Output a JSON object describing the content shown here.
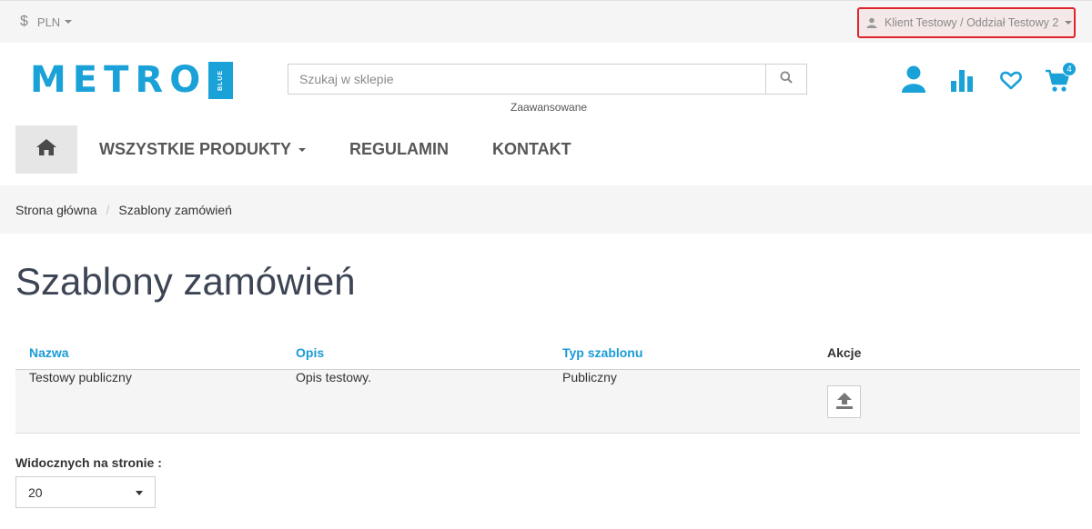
{
  "topbar": {
    "currency_symbol": "$",
    "currency": "PLN",
    "account_label": "Klient Testowy / Oddział Testowy 2"
  },
  "header": {
    "logo_text": "METRO",
    "logo_sub": "BLUE",
    "search_placeholder": "Szukaj w sklepie",
    "advanced_link": "Zaawansowane",
    "cart_count": "4",
    "icons": [
      "user-icon",
      "stats-icon",
      "heart-icon",
      "cart-icon",
      "search-icon"
    ]
  },
  "nav": {
    "items": [
      {
        "label": "WSZYSTKIE PRODUKTY"
      },
      {
        "label": "REGULAMIN"
      },
      {
        "label": "KONTAKT"
      }
    ]
  },
  "breadcrumb": [
    "Strona główna",
    "Szablony zamówień"
  ],
  "page": {
    "title": "Szablony zamówień"
  },
  "table": {
    "headers": [
      "Nazwa",
      "Opis",
      "Typ szablonu",
      "Akcje"
    ],
    "rows": [
      {
        "name": "Testowy publiczny",
        "desc": "Opis testowy.",
        "type": "Publiczny"
      }
    ]
  },
  "per_page": {
    "label": "Widocznych na stronie :",
    "value": "20"
  },
  "colors": {
    "accent": "#1aa2d8",
    "highlight_border": "#e0242b",
    "title": "#3d4555"
  }
}
